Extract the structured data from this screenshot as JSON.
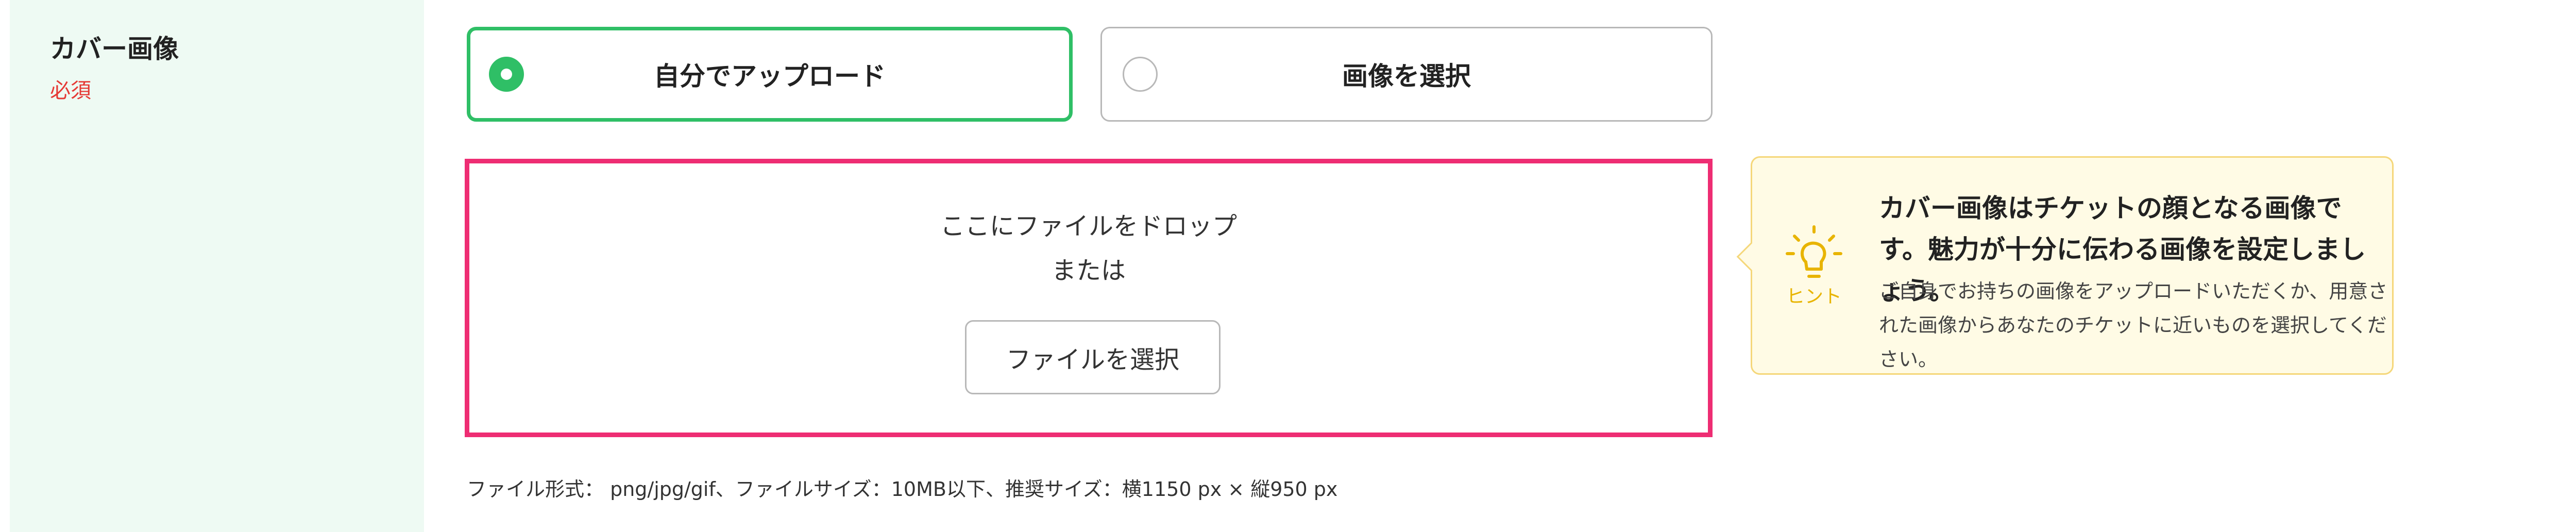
{
  "field": {
    "label": "カバー画像",
    "required": "必須"
  },
  "options": [
    {
      "label": "自分でアップロード",
      "selected": true
    },
    {
      "label": "画像を選択",
      "selected": false
    }
  ],
  "dropzone": {
    "line1": "ここにファイルをドロップ",
    "line2": "または",
    "button": "ファイルを選択"
  },
  "file_info": "ファイル形式： png/jpg/gif、ファイルサイズ：10MB以下、推奨サイズ：横1150 px × 縦950 px",
  "hint": {
    "icon": "lightbulb-icon",
    "icon_label": "ヒント",
    "title": "カバー画像はチケットの顔となる画像です。魅力が十分に伝わる画像を設定しましょう。",
    "body": "ご自身でお持ちの画像をアップロードいただくか、用意された画像からあなたのチケットに近いものを選択してください。"
  },
  "colors": {
    "accent_green": "#2fbf66",
    "dropzone_border": "#ee2d73",
    "required_red": "#e53935",
    "hint_yellow": "#e8b400",
    "label_bg": "#eefaf3",
    "hint_bg": "#fffbe5"
  }
}
